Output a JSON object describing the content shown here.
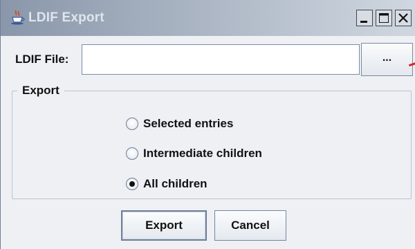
{
  "window": {
    "title": "LDIF Export",
    "controls": {
      "minimize": "minimize-icon",
      "maximize": "maximize-icon",
      "close": "close-icon"
    },
    "app_icon": "java-cup-icon"
  },
  "file_row": {
    "label": "LDIF File:",
    "value": "",
    "browse_label": "..."
  },
  "export_group": {
    "legend": "Export",
    "options": [
      {
        "label": "Selected entries",
        "checked": false
      },
      {
        "label": "Intermediate children",
        "checked": false
      },
      {
        "label": "All children",
        "checked": true
      }
    ]
  },
  "buttons": {
    "export_label": "Export",
    "cancel_label": "Cancel"
  },
  "colors": {
    "titlebar_start": "#8a97aa",
    "titlebar_end": "#d0d7e0",
    "window_bg": "#eef0f4",
    "accent_mark": "#d6262b"
  }
}
